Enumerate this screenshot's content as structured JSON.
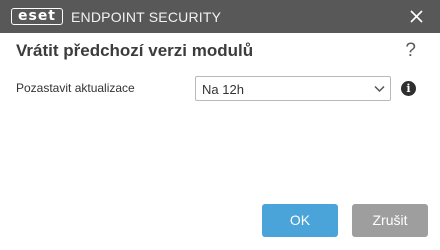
{
  "titlebar": {
    "logo_text": "eset",
    "product_name": "ENDPOINT SECURITY",
    "close_icon": "close-icon"
  },
  "dialog": {
    "title": "Vrátit předchozí verzi modulů",
    "help_icon": "?",
    "pause_label": "Pozastavit aktualizace",
    "pause_value": "Na 12h",
    "info_icon": "i"
  },
  "buttons": {
    "ok": "OK",
    "cancel": "Zrušit"
  },
  "colors": {
    "titlebar": "#585858",
    "primary": "#4aa3d9",
    "secondary": "#9e9e9e"
  }
}
